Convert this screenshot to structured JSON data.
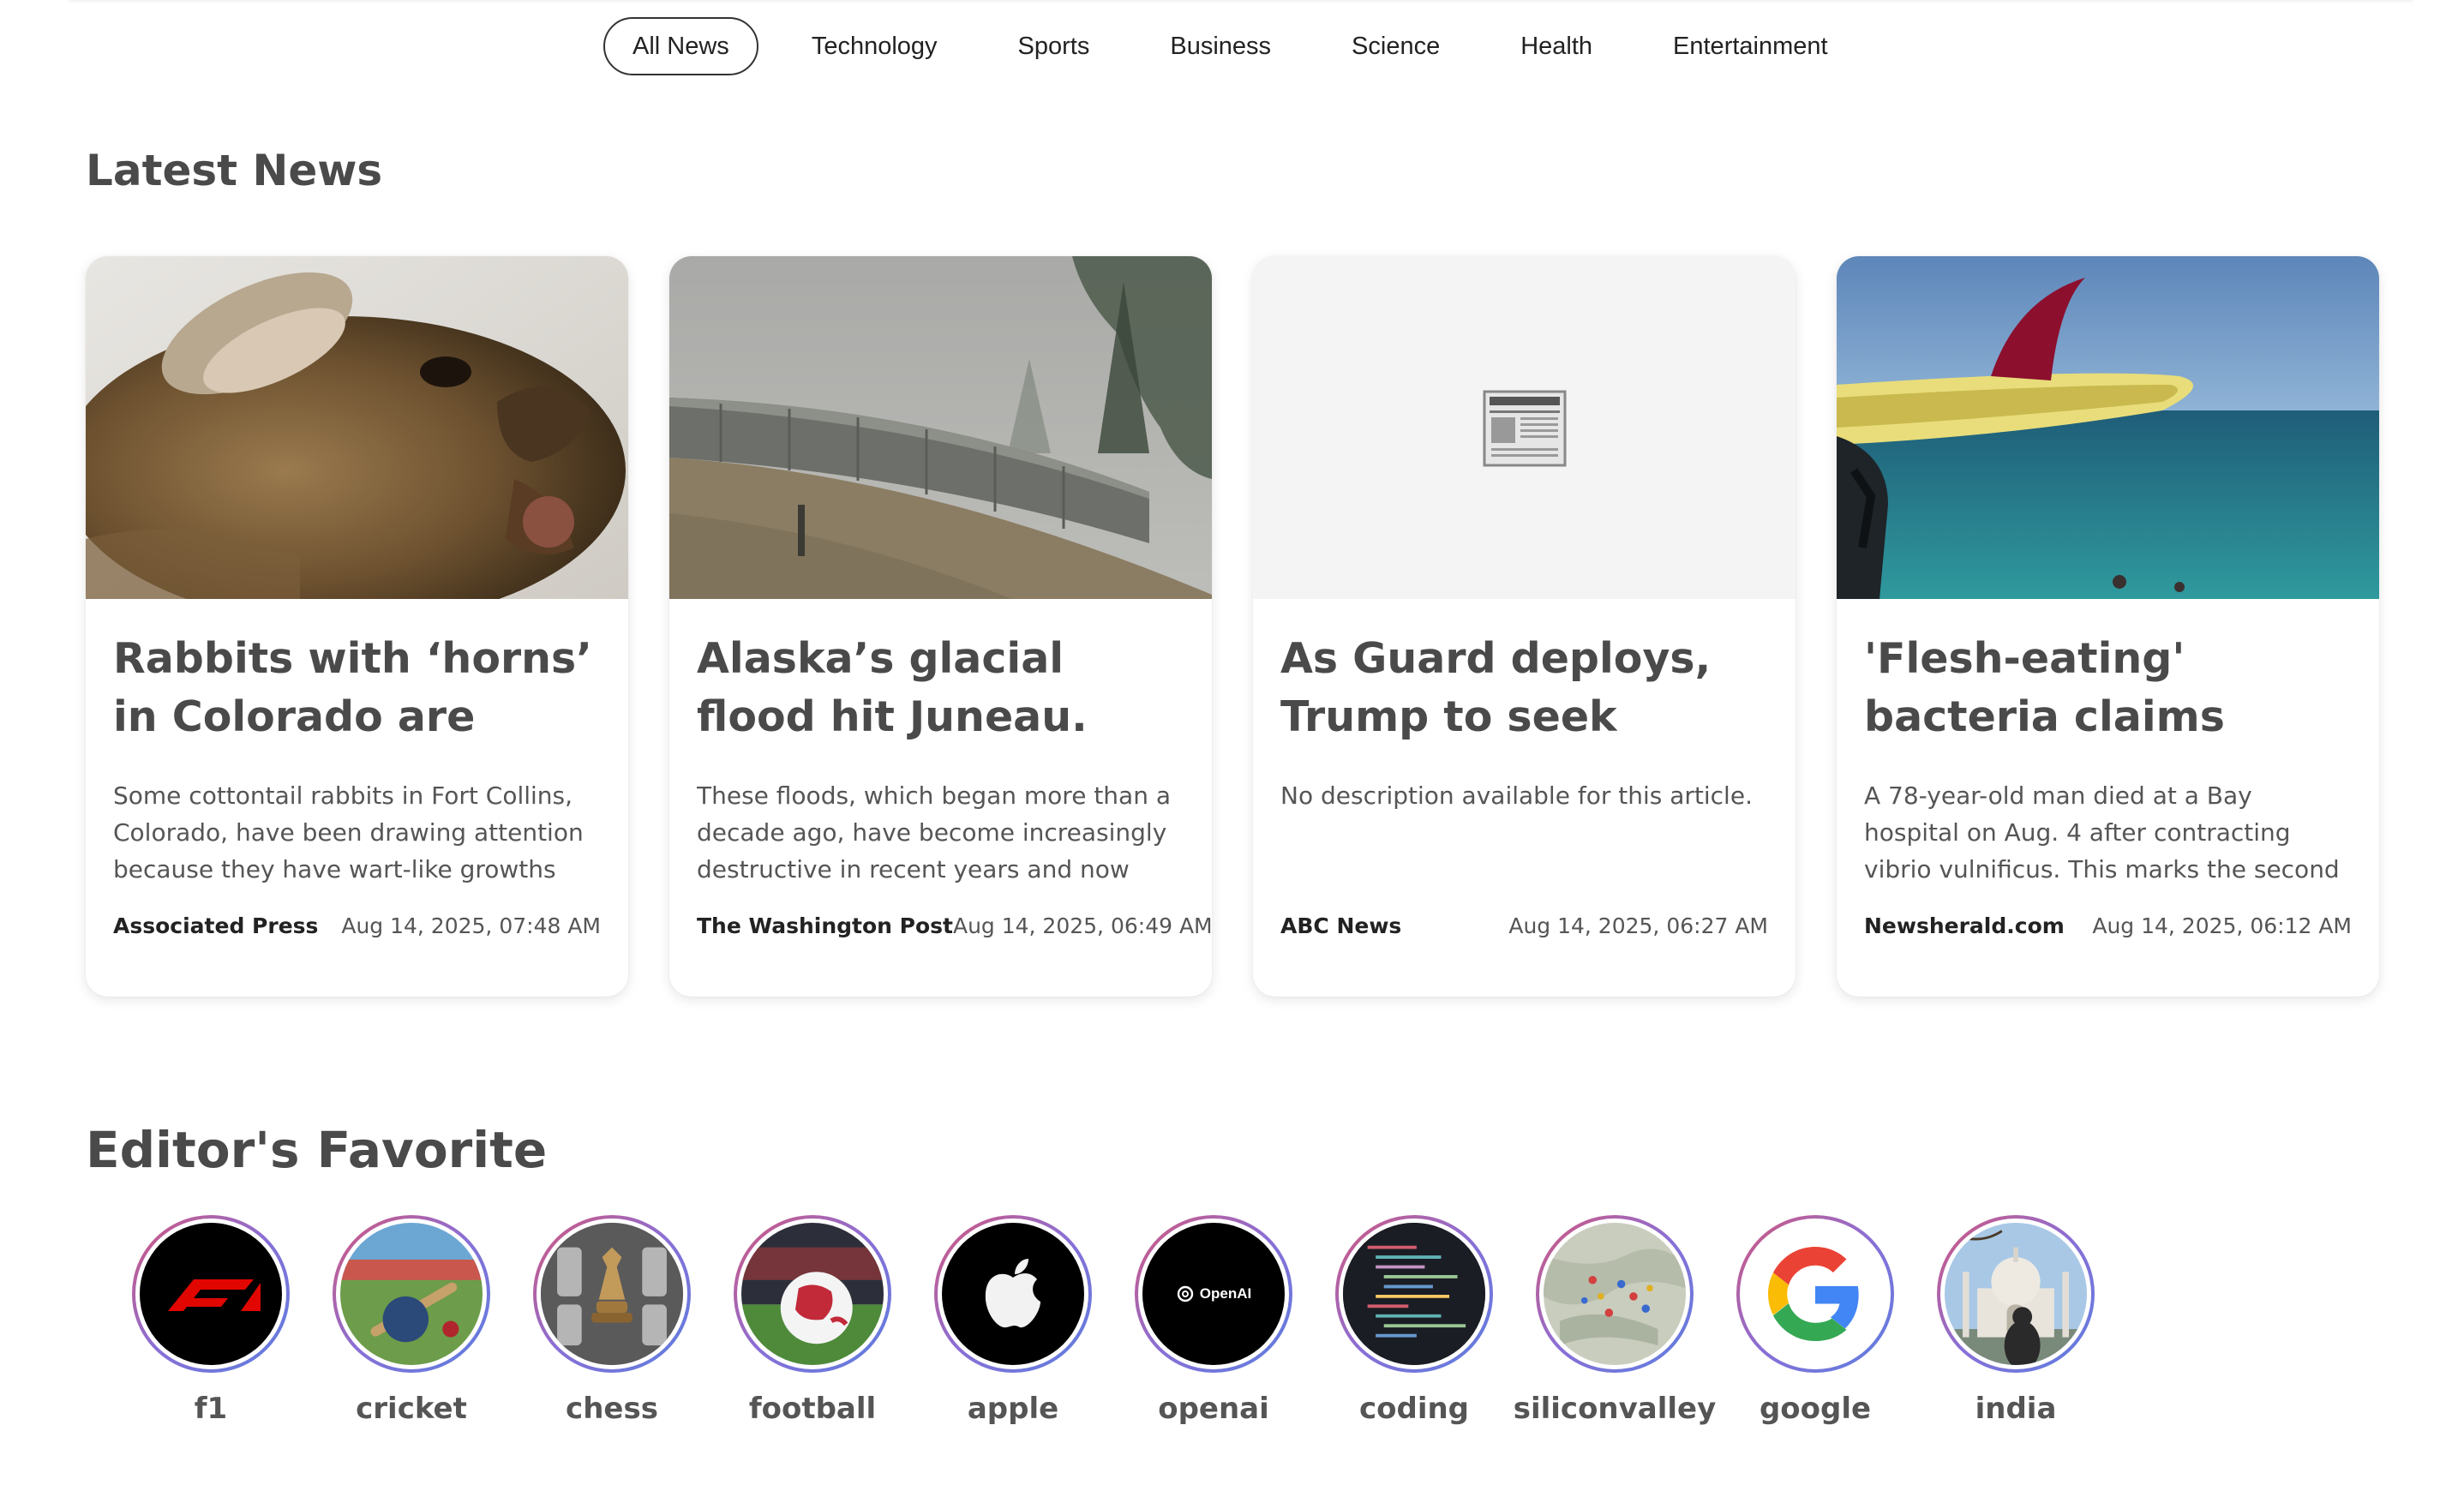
{
  "nav": {
    "tabs": [
      {
        "label": "All News",
        "active": true
      },
      {
        "label": "Technology"
      },
      {
        "label": "Sports"
      },
      {
        "label": "Business"
      },
      {
        "label": "Science"
      },
      {
        "label": "Health"
      },
      {
        "label": "Entertainment"
      }
    ]
  },
  "latest": {
    "title": "Latest News",
    "cards": [
      {
        "title": "Rabbits with ‘horns’ in Colorado are being...",
        "description": "Some cottontail rabbits in Fort Collins, Colorado, have been drawing attention because they have wart-like growths on...",
        "source": "Associated Press",
        "date": "Aug 14, 2025, 07:48 AM",
        "image": "rabbit-photo"
      },
      {
        "title": "Alaska’s glacial flood hit Juneau. Its...",
        "description": "These floods, which began more than a decade ago, have become increasingly destructive in recent years and now pose ...",
        "source": "The Washington Post",
        "date": "Aug 14, 2025, 06:49 AM",
        "image": "flood-barrier-photo"
      },
      {
        "title": "As Guard deploys, Trump to seek 'long-...",
        "description": "No description available for this article.",
        "source": "ABC News",
        "date": "Aug 14, 2025, 06:27 AM",
        "image": "newspaper-placeholder-icon"
      },
      {
        "title": "'Flesh-eating' bacteria claims second Bay...",
        "description": "A 78-year-old man died at a Bay hospital on Aug. 4 after contracting vibrio vulnificus. This marks the second local vibrio vulnificu...",
        "source": "Newsherald.com",
        "date": "Aug 14, 2025, 06:12 AM",
        "image": "surfboard-beach-photo"
      }
    ]
  },
  "favorites": {
    "title": "Editor's Favorite",
    "items": [
      {
        "label": "f1",
        "icon": "f1-logo-icon"
      },
      {
        "label": "cricket",
        "icon": "cricket-icon"
      },
      {
        "label": "chess",
        "icon": "chess-icon"
      },
      {
        "label": "football",
        "icon": "football-icon"
      },
      {
        "label": "apple",
        "icon": "apple-logo-icon"
      },
      {
        "label": "openai",
        "icon": "openai-logo-icon",
        "logo_text": "OpenAI"
      },
      {
        "label": "coding",
        "icon": "code-screen-icon"
      },
      {
        "label": "siliconvalley",
        "icon": "map-icon"
      },
      {
        "label": "google",
        "icon": "google-logo-icon"
      },
      {
        "label": "india",
        "icon": "taj-mahal-icon"
      }
    ]
  },
  "colors": {
    "accent_ring_start": "#d4567a",
    "accent_ring_end": "#5a7fe0",
    "google_blue": "#4285F4",
    "google_red": "#EA4335",
    "google_yellow": "#FBBC05",
    "google_green": "#34A853",
    "f1_red": "#e10600"
  }
}
